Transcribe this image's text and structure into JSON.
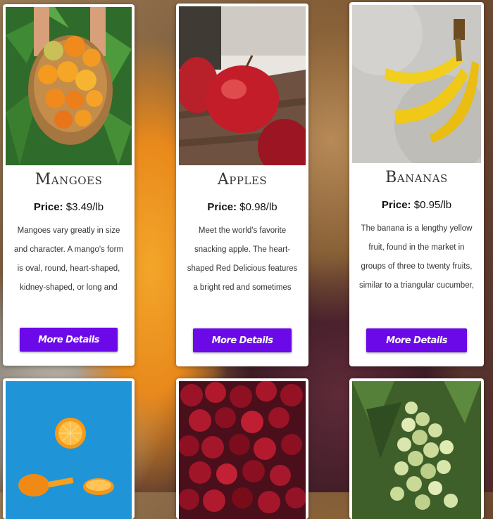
{
  "products": [
    {
      "name": "Mangoes",
      "price_label": "Price:",
      "price": "$3.49/lb",
      "description": "Mangoes vary greatly in size and character. A mango's form is oval, round, heart-shaped, kidney-shaped, or long and slender. The smallest…",
      "button": "More Details"
    },
    {
      "name": "Apples",
      "price_label": "Price:",
      "price": "$0.98/lb",
      "description": "Meet the world's favorite snacking apple. The heart-shaped Red Delicious features a bright red and sometimes striped skin. Renowne…",
      "button": "More Details"
    },
    {
      "name": "Bananas",
      "price_label": "Price:",
      "price": "$0.95/lb",
      "description": "The banana is a lengthy yellow fruit, found in the market in groups of three to twenty fruits, similar to a triangular cucumber, oblong and normally…",
      "button": "More Details"
    }
  ],
  "colors": {
    "button": "#6b09e8",
    "card": "#ffffff"
  },
  "images": [
    "mangoes-in-basket",
    "red-apples-on-table",
    "banana-bunch",
    "floating-orange-slices",
    "red-cherries",
    "green-grapes"
  ]
}
